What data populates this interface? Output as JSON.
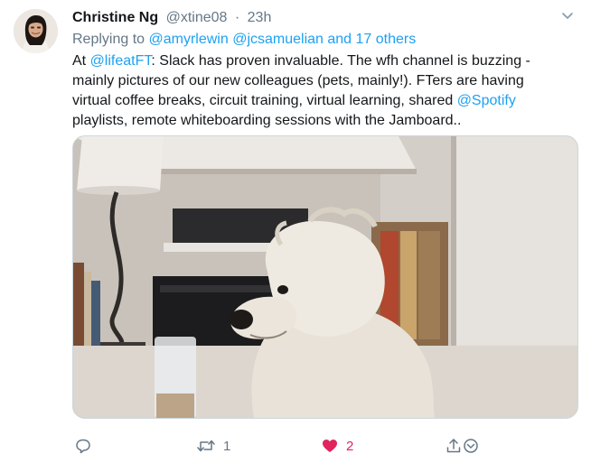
{
  "tweet": {
    "author_name": "Christine Ng",
    "author_handle": "@xtine08",
    "separator": "·",
    "time_ago": "23h",
    "reply_prefix": "Replying to",
    "reply_mentions": "@amyrlewin @jcsamuelian and 17 others",
    "text_lines": [
      {
        "pre": "At ",
        "mention": "@lifeatFT",
        "post": ":  Slack has proven invaluable. The wfh channel is buzzing -"
      },
      {
        "pre": "mainly pictures of our new colleagues (pets, mainly!). FTers are having",
        "mention": "",
        "post": ""
      },
      {
        "pre": "virtual coffee breaks, circuit training, virtual learning, shared ",
        "mention": "@Spotify",
        "post": ""
      },
      {
        "pre": " playlists, remote whiteboarding sessions with the Jamboard..",
        "mention": "",
        "post": ""
      }
    ],
    "media_subject": "photo-of-white-terrier-dog-at-desk"
  },
  "actions": {
    "reply_icon": "reply-icon",
    "retweet_icon": "retweet-icon",
    "retweet_count": "1",
    "like_icon": "heart-icon",
    "like_count": "2",
    "like_color": "#e0245e",
    "share_icon": "share-icon",
    "dm_icon": "direct-message-icon"
  },
  "colors": {
    "link": "#1da1f2",
    "secondary_text": "#657786",
    "border": "#ccd6dd"
  }
}
